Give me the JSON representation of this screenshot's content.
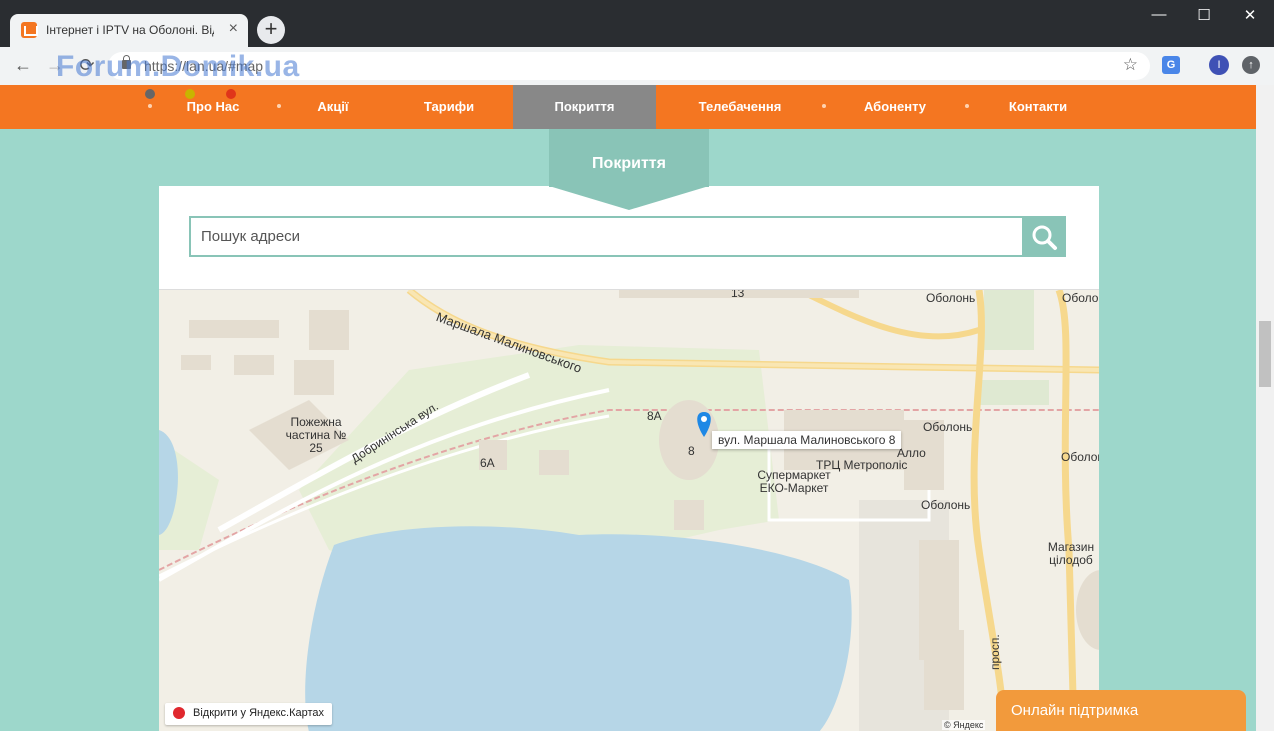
{
  "browser": {
    "tab_title": "Інтернет і IPTV на Оболоні. Від",
    "tab_close": "×",
    "new_tab": "+",
    "url": "https://lan.ua/#map",
    "win_minimize": "—",
    "win_maximize": "☐",
    "win_close": "✕",
    "back": "←",
    "forward": "→",
    "reload": "⟳",
    "star": "☆",
    "translate": "G",
    "profile_initial": "I",
    "update": "↑"
  },
  "watermark": "Forum.Domik.ua",
  "nav": {
    "dot_colors": [
      "#666666",
      "#c8b400",
      "#e0351a"
    ],
    "items": [
      {
        "label": "Про Нас"
      },
      {
        "label": "Акції"
      },
      {
        "label": "Тарифи"
      },
      {
        "label": "Покриття"
      },
      {
        "label": "Телебачення"
      },
      {
        "label": "Абоненту"
      },
      {
        "label": "Контакти"
      }
    ],
    "active_index": 3
  },
  "section": {
    "title": "Покриття"
  },
  "search": {
    "placeholder": "Пошук адреси",
    "icon": "search-icon"
  },
  "map": {
    "labels": {
      "street_malynovskoho": "Маршала Малиновського",
      "street_dobryninska": "Добринінська вул.",
      "fire_station": "Пожежна частина № 25",
      "house_13": "13",
      "house_8a": "8А",
      "house_8": "8",
      "house_6a": "6А",
      "obolon_1": "Оболонь",
      "obolon_2": "Оболон",
      "obolon_3": "Оболонь",
      "obolon_4": "Оболон",
      "obolon_5": "Оболонь",
      "allo": "Алло",
      "trc": "ТРЦ Метрополіс",
      "supermarket": "Супермаркет ЕКО-Маркет",
      "magazin": "Магазин цілодоб",
      "prosp": "просп."
    },
    "balloon": "вул. Маршала Малиновського 8",
    "open_yandex": "Відкрити у Яндекс.Картах",
    "copyright": "© Яндекс"
  },
  "support": {
    "label": "Онлайн підтримка"
  }
}
